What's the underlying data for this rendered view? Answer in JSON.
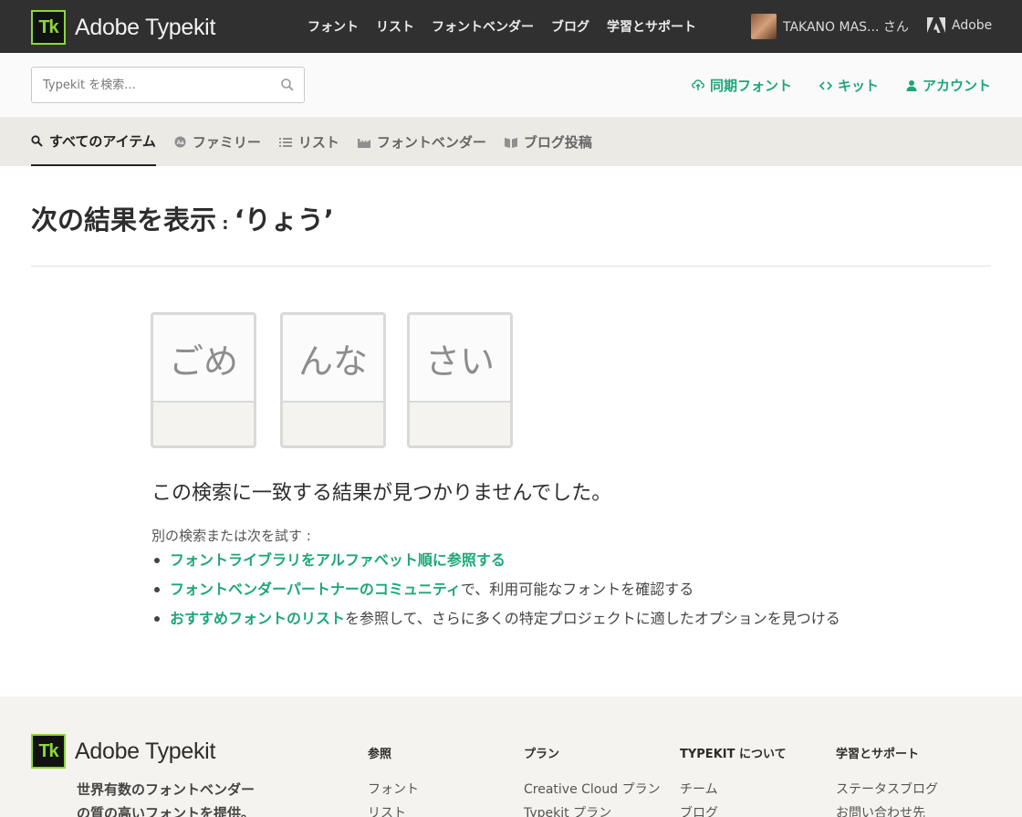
{
  "header": {
    "logo_letters": "Tk",
    "brand": "Adobe Typekit",
    "nav": [
      "フォント",
      "リスト",
      "フォントベンダー",
      "ブログ",
      "学習とサポート"
    ],
    "user_name": "TAKANO MAS... さん",
    "adobe_label": "Adobe"
  },
  "search": {
    "placeholder": "Typekit を検索..."
  },
  "actions": {
    "sync": "同期フォント",
    "kit": "キット",
    "account": "アカウント"
  },
  "tabs": {
    "all": "すべてのアイテム",
    "family": "ファミリー",
    "list": "リスト",
    "vendor": "フォントベンダー",
    "blog": "ブログ投稿"
  },
  "result": {
    "prefix": "次の結果を表示",
    "colon": " : ",
    "query": "‘りょう’"
  },
  "cards": [
    "ごめ",
    "んな",
    "さい"
  ],
  "no_results": "この検索に一致する結果が見つかりませんでした。",
  "suggest": {
    "intro": "別の検索または次を試す :",
    "item1_link": "フォントライブラリをアルファベット順に参照する",
    "item2_link": "フォントベンダーパートナーのコミュニティ",
    "item2_rest": "で、利用可能なフォントを確認する",
    "item3_link": "おすすめフォントのリスト",
    "item3_rest": "を参照して、さらに多くの特定プロジェクトに適したオプションを見つける"
  },
  "footer": {
    "brand": "Adobe Typekit",
    "tagline_line1": "世界有数のフォントベンダー",
    "tagline_line2": "の質の高いフォントを提供。",
    "columns": [
      {
        "title": "参照",
        "items": [
          "フォント",
          "リスト"
        ]
      },
      {
        "title": "プラン",
        "items": [
          "Creative Cloud プラン",
          "Typekit プラン"
        ]
      },
      {
        "title": "TYPEKIT について",
        "items": [
          "チーム",
          "ブログ"
        ]
      },
      {
        "title": "学習とサポート",
        "items": [
          "ステータスブログ",
          "お問い合わせ先"
        ]
      }
    ]
  },
  "colors": {
    "accent_green": "#1ea67a",
    "topbar": "#303030",
    "logo_green": "#8ed63a"
  }
}
